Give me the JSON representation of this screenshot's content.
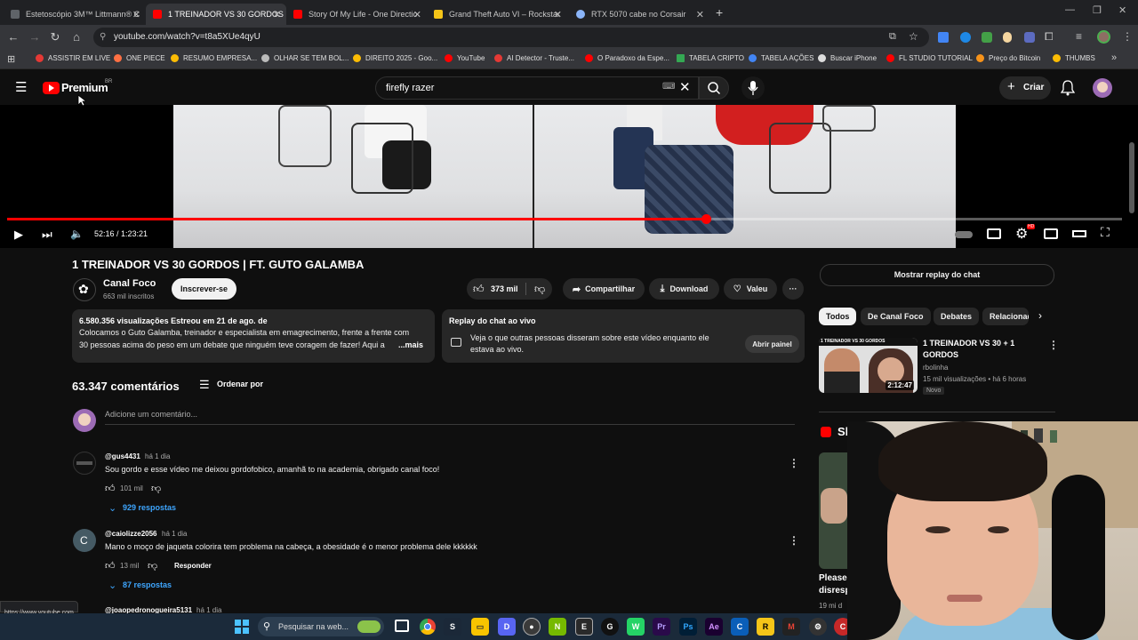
{
  "browser": {
    "tabs": [
      {
        "title": "Estetoscópio 3M™ Littmann® C",
        "active": false,
        "color": "#5f6368"
      },
      {
        "title": "1 TREINADOR VS 30 GORDOS |",
        "active": true,
        "color": "#ff0000"
      },
      {
        "title": "Story Of My Life - One Directio",
        "active": false,
        "color": "#ff0000"
      },
      {
        "title": "Grand Theft Auto VI – Rockstar",
        "active": false,
        "color": "#f5c518"
      },
      {
        "title": "RTX 5070 cabe no Corsair",
        "active": false,
        "color": "#8ab4f8"
      }
    ],
    "url": "youtube.com/watch?v=t8a5XUe4qyU",
    "bookmarks": [
      {
        "label": "ASSISTIR EM LIVE",
        "color": "#e53935"
      },
      {
        "label": "ONE PIECE",
        "color": "#ff7043"
      },
      {
        "label": "RESUMO EMPRESA...",
        "color": "#fbbc04"
      },
      {
        "label": "OLHAR SE TEM BOL...",
        "color": "#bbbbbb"
      },
      {
        "label": "DIREITO 2025 - Goo...",
        "color": "#fbbc04"
      },
      {
        "label": "YouTube",
        "color": "#ff0000"
      },
      {
        "label": "AI Detector - Truste...",
        "color": "#e53935"
      },
      {
        "label": "O Paradoxo da Espe...",
        "color": "#ff0000"
      },
      {
        "label": "TABELA CRIPTO",
        "color": "#34a853"
      },
      {
        "label": "TABELA AÇÕES",
        "color": "#4285f4"
      },
      {
        "label": "Buscar iPhone",
        "color": "#dddddd"
      },
      {
        "label": "FL STUDIO TUTORIAL",
        "color": "#ff0000"
      },
      {
        "label": "Preço do Bitcoin",
        "color": "#f7931a"
      },
      {
        "label": "THUMBS",
        "color": "#fbbc04"
      }
    ],
    "status_url": "https://www.youtube.com"
  },
  "youtube": {
    "logo_text": "Premium",
    "region": "BR",
    "search_value": "firefly razer",
    "create_label": "Criar"
  },
  "player": {
    "time": "52:16 / 1:23:21",
    "progress": 0.627
  },
  "video": {
    "title": "1 TREINADOR VS 30 GORDOS | FT. GUTO GALAMBA",
    "channel": "Canal Foco",
    "subscribers": "663 mil inscritos",
    "subscribe_label": "Inscrever-se",
    "likes": "373 mil",
    "share_label": "Compartilhar",
    "download_label": "Download",
    "thanks_label": "Valeu",
    "views_line": "6.580.356 visualizações  Estreou em 21 de ago. de",
    "description_1": "Colocamos o Guto Galamba, treinador e especialista em emagrecimento, frente a frente com",
    "description_2": "30 pessoas acima do peso em um debate que ninguém teve coragem de fazer! Aqui a",
    "more_label": "...mais"
  },
  "chat_replay": {
    "title": "Replay do chat ao vivo",
    "text_1": "Veja o que outras pessoas disseram sobre este vídeo enquanto ele",
    "text_2": "estava ao vivo.",
    "open_label": "Abrir painel",
    "show_replay_label": "Mostrar replay do chat"
  },
  "comments": {
    "count": "63.347 comentários",
    "sort_label": "Ordenar por",
    "add_placeholder": "Adicione um comentário...",
    "items": [
      {
        "author": "@gus4431",
        "time": "há 1 dia",
        "text": "Sou gordo e esse vídeo me deixou gordofobico, amanhã to na academia, obrigado canal foco!",
        "likes": "101 mil",
        "replies": "929 respostas"
      },
      {
        "author": "@caiolizze2056",
        "time": "há 1 dia",
        "text": "Mano o moço de jaqueta colorira tem problema na cabeça, a obesidade é o menor problema dele kkkkkk",
        "likes": "13 mil",
        "reply_label": "Responder",
        "replies": "87 respostas",
        "avatar_letter": "C"
      },
      {
        "author": "@joaopedronogueira5131",
        "time": "há 1 dia"
      }
    ]
  },
  "sidebar": {
    "chips": [
      "Todos",
      "De Canal Foco",
      "Debates",
      "Relacionad"
    ],
    "rec": {
      "title_1": "1 TREINADOR VS 30 + 1",
      "title_2": "GORDOS",
      "channel": "rbolinha",
      "meta": "15 mil visualizações • há 6 horas",
      "badge": "Novo",
      "duration": "2:12:47",
      "thumb_caption": "1 TREINADOR VS 30 GORDOS"
    },
    "shorts_label": "Sh",
    "short_title_1": "Please",
    "short_title_2": "disresp",
    "short_meta": "19 mi d"
  },
  "taskbar": {
    "search_placeholder": "Pesquisar na web...",
    "apps": [
      "chrome",
      "steam",
      "files",
      "discord",
      "obs",
      "nvidia",
      "epic",
      "github",
      "whatsapp",
      "premiere",
      "photoshop",
      "aftereffects",
      "capcut",
      "rockstar",
      "gmail",
      "gear",
      "chrome2"
    ]
  }
}
